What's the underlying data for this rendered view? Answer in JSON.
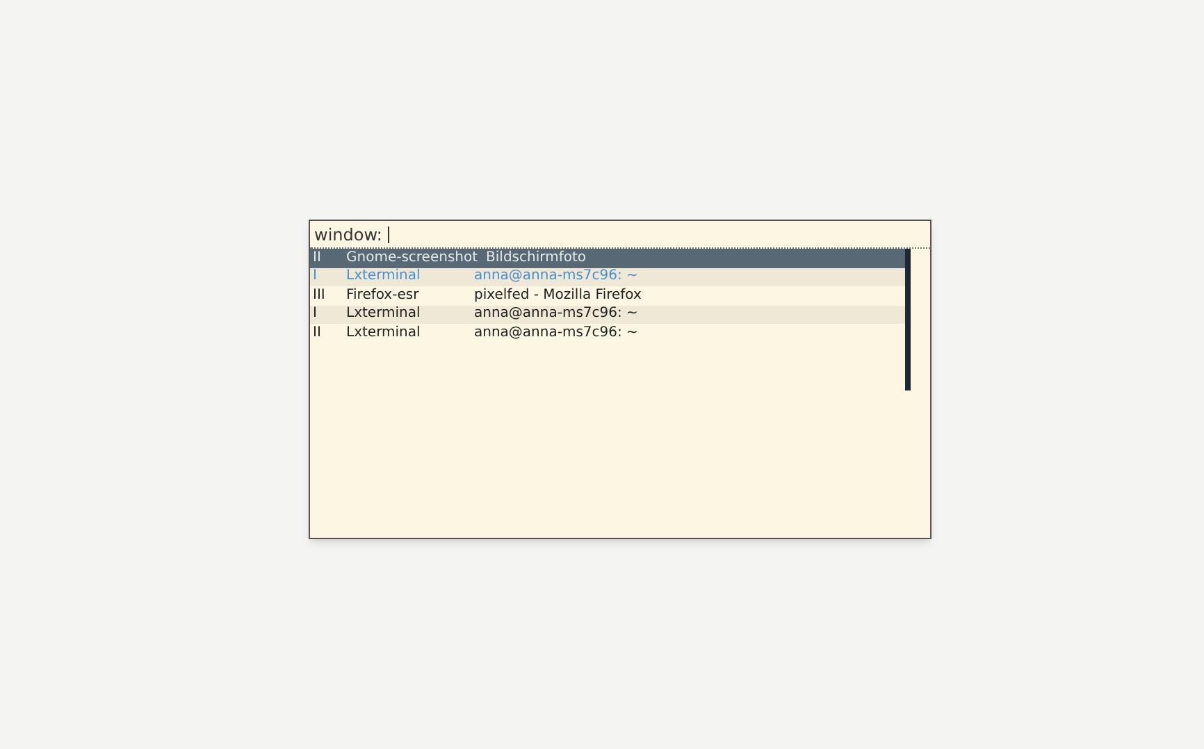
{
  "prompt": {
    "label": "window:"
  },
  "windows": [
    {
      "desktop": "II",
      "app": "Gnome-screenshot",
      "title": "Bildschirmfoto",
      "selected": true,
      "current": false
    },
    {
      "desktop": "I",
      "app": "Lxterminal",
      "title": "anna@anna-ms7c96: ~",
      "selected": false,
      "current": true
    },
    {
      "desktop": "III",
      "app": "Firefox-esr",
      "title": "pixelfed - Mozilla Firefox",
      "selected": false,
      "current": false
    },
    {
      "desktop": "I",
      "app": "Lxterminal",
      "title": "anna@anna-ms7c96: ~",
      "selected": false,
      "current": false
    },
    {
      "desktop": "II",
      "app": "Lxterminal",
      "title": "anna@anna-ms7c96: ~",
      "selected": false,
      "current": false
    }
  ]
}
